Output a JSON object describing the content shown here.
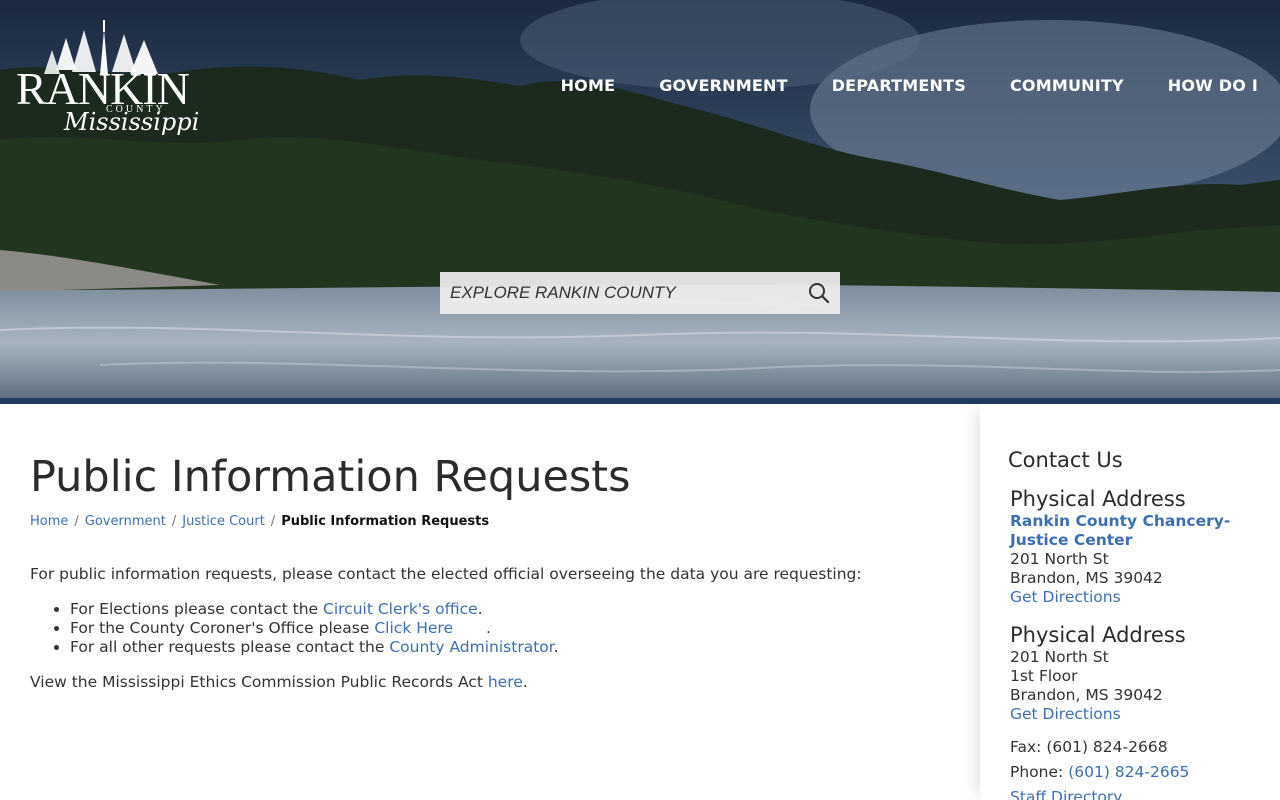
{
  "site": {
    "logo_name": "RANKIN",
    "logo_subname": "COUNTY",
    "logo_state": "Mississippi"
  },
  "nav": {
    "items": [
      {
        "label": "HOME"
      },
      {
        "label": "GOVERNMENT"
      },
      {
        "label": "DEPARTMENTS"
      },
      {
        "label": "COMMUNITY"
      },
      {
        "label": "HOW DO I"
      }
    ]
  },
  "search": {
    "placeholder": "EXPLORE RANKIN COUNTY",
    "icon": "search-icon"
  },
  "page": {
    "title": "Public Information Requests",
    "breadcrumb": [
      {
        "label": "Home"
      },
      {
        "label": "Government"
      },
      {
        "label": "Justice Court"
      },
      {
        "label": "Public Information Requests"
      }
    ],
    "intro": "For public information requests, please contact the elected official overseeing the data you are requesting:",
    "list": [
      {
        "prefix": "For Elections please contact the ",
        "link": "Circuit Clerk's office",
        "suffix": "."
      },
      {
        "prefix": "For the County Coroner's Office please ",
        "link": "Click Here",
        "suffix": "."
      },
      {
        "prefix": "For all other requests please contact the ",
        "link": "County Administrator",
        "suffix": "."
      }
    ],
    "ethics": {
      "prefix": "View the Mississippi Ethics Commission Public Records Act ",
      "link": "here",
      "suffix": "."
    }
  },
  "sidebar": {
    "title": "Contact Us",
    "address1": {
      "heading": "Physical Address",
      "org": "Rankin County Chancery-Justice Center",
      "line1": "201 North St",
      "line2": "Brandon, MS 39042",
      "directions": "Get Directions"
    },
    "address2": {
      "heading": "Physical Address",
      "line1": "201 North St",
      "line2": "1st Floor",
      "line3": "Brandon, MS 39042",
      "directions": "Get Directions"
    },
    "fax_label": "Fax:",
    "fax": "(601) 824-2668",
    "phone_label": "Phone:",
    "phone": "(601) 824-2665",
    "staff_directory": "Staff Directory"
  },
  "colors": {
    "link": "#3d6fb0",
    "nav_text": "#ffffff",
    "hero_bar": "#1e3a5f"
  }
}
